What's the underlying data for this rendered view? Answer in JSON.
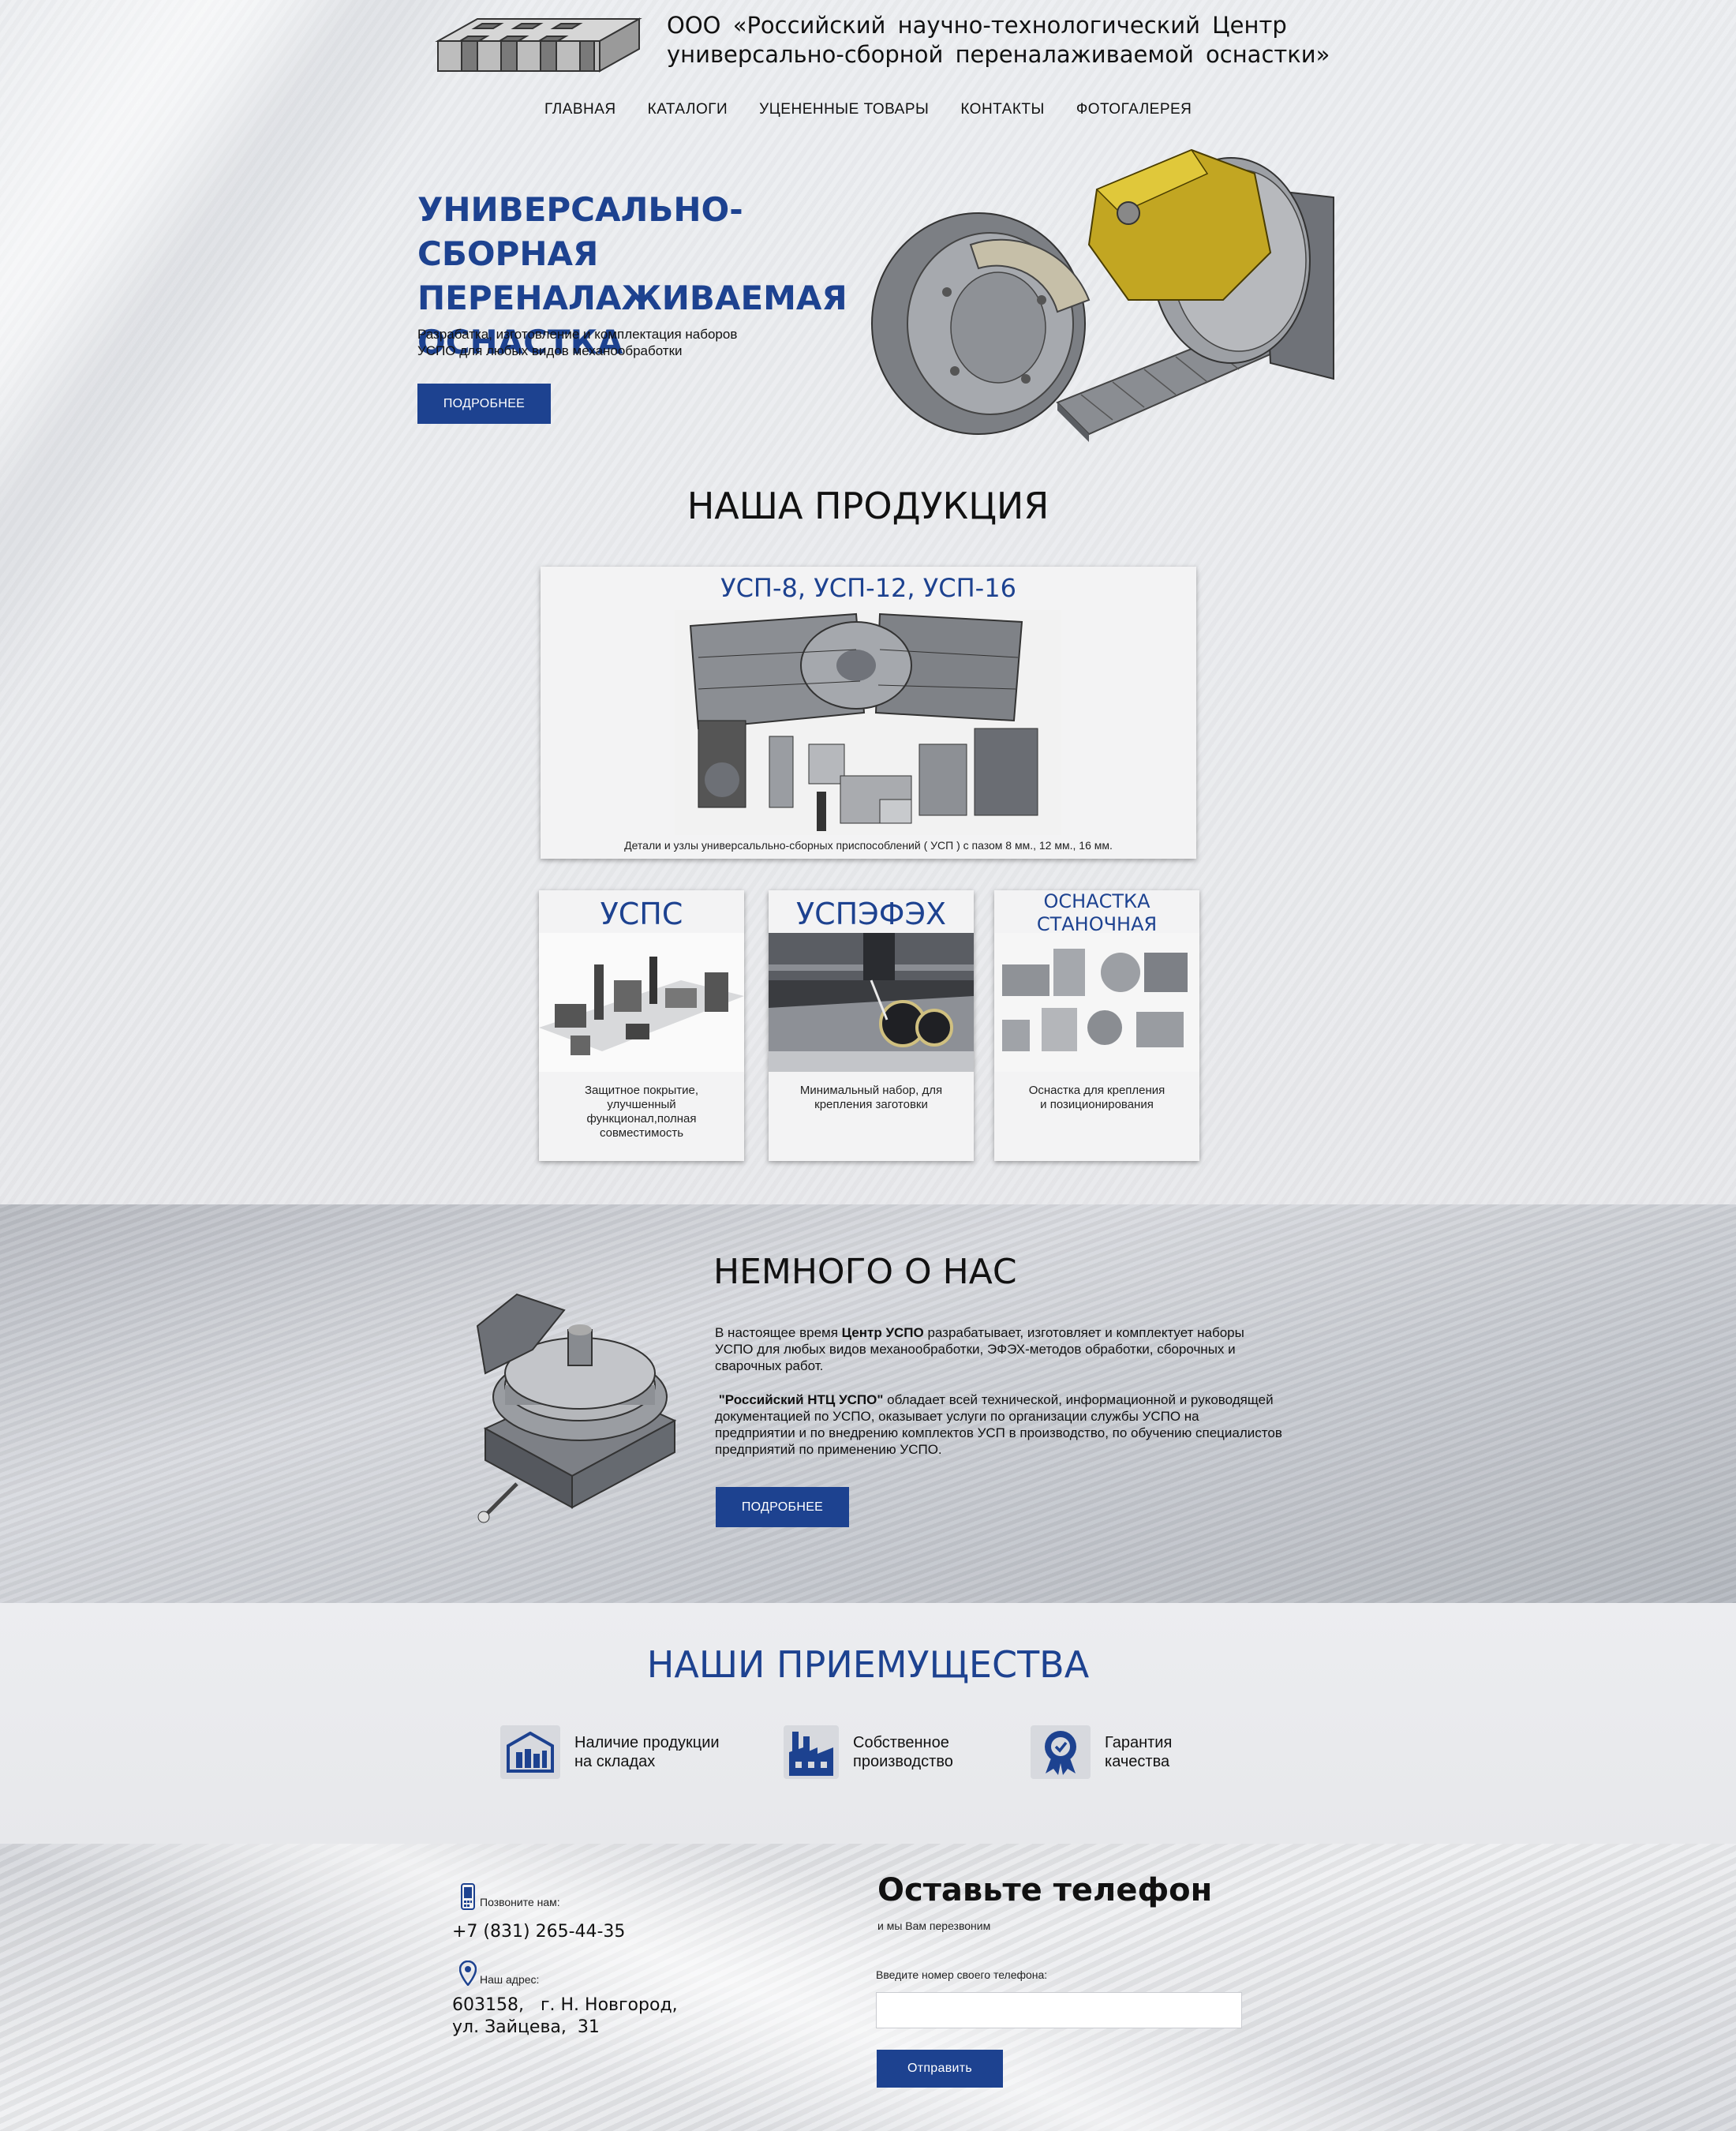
{
  "header": {
    "company_line1": "ООО «Российский научно-технологический Центр",
    "company_line2": "универсально-сборной переналаживаемой оснастки»",
    "nav": [
      "ГЛАВНАЯ",
      "КАТАЛОГИ",
      "УЦЕНЕННЫЕ ТОВАРЫ",
      "КОНТАКТЫ",
      "ФОТОГАЛЕРЕЯ"
    ]
  },
  "hero": {
    "title_line1": "УНИВЕРСАЛЬНО-СБОРНАЯ",
    "title_line2": "ПЕРЕНАЛАЖИВАЕМАЯ",
    "title_line3": "ОСНАСТКА",
    "subtitle_line1": "Разрабатка, изготовление и комплектация наборов",
    "subtitle_line2": "УСПО для любых видов механообработки",
    "button": "ПОДРОБНЕЕ"
  },
  "products": {
    "title": "НАША ПРОДУКЦИЯ",
    "main_card": {
      "title": "УСП-8, УСП-12, УСП-16",
      "caption": "Детали и узлы универсальльно-сборных приспособлений ( УСП ) с пазом 8 мм., 12 мм., 16 мм."
    },
    "cards": [
      {
        "title": "УСПС",
        "caption_lines": [
          "Защитное покрытие,",
          "улучшенный",
          "функционал,полная",
          "совместимость"
        ]
      },
      {
        "title": "УСПЭФЭХ",
        "caption_lines": [
          "Минимальный набор, для",
          "крепления заготовки"
        ]
      },
      {
        "title_lines": [
          "ОСНАСТКА",
          "СТАНОЧНАЯ"
        ],
        "caption_lines": [
          "Оснастка для крепления",
          "и позиционирования"
        ]
      }
    ]
  },
  "about": {
    "title": "НЕМНОГО О НАС",
    "p1_pre": "В настоящее время ",
    "p1_bold": "Центр УСПО",
    "p1_post": " разрабатывает, изготовляет и комплектует наборы УСПО для любых видов механообработки, ЭФЭХ-методов обработки, сборочных и сварочных работ.",
    "p2_bold": "\"Российский НТЦ УСПО\"",
    "p2_post": " обладает всей технической, информационной и руководящей документацией по УСПО, оказывает услуги по организации службы УСПО на предприятии и по внедрению комплектов УСП в производство, по обучению специалистов предприятий по применению УСПО.",
    "button": "ПОДРОБНЕЕ"
  },
  "advantages": {
    "title": "НАШИ ПРИЕМУЩЕСТВА",
    "items": [
      {
        "icon": "warehouse-icon",
        "line1": "Наличие продукции",
        "line2": "на складах"
      },
      {
        "icon": "factory-icon",
        "line1": "Собственное",
        "line2": "производство"
      },
      {
        "icon": "quality-badge-icon",
        "line1": "Гарантия",
        "line2": "качества"
      }
    ]
  },
  "footer": {
    "call_label": "Позвоните нам:",
    "phone": "+7 (831) 265-44-35",
    "address_label": "Наш адрес:",
    "address_line1": "603158,   г. Н. Новгород,",
    "address_line2": "ул. Зайцева,  31",
    "callback_title": "Оставьте телефон",
    "callback_sub": "и мы Вам перезвоним",
    "phone_field_label": "Введите номер своего телефона:",
    "phone_field_value": "",
    "submit": "Отправить"
  },
  "colors": {
    "accent": "#1d4290"
  }
}
